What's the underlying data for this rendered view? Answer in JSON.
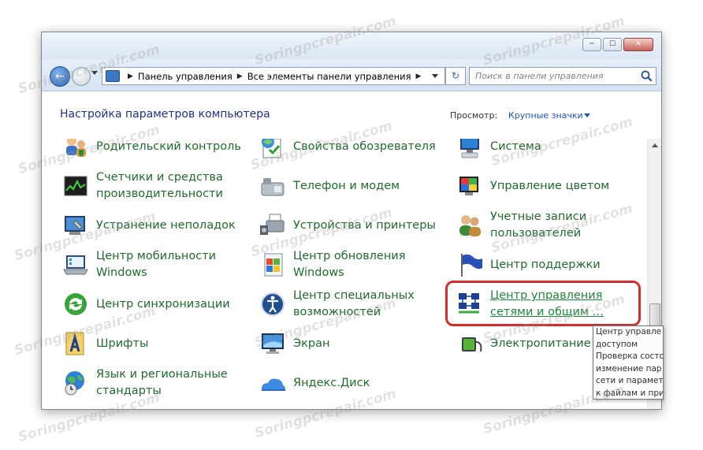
{
  "window": {
    "buttons": {
      "minimize": "─",
      "maximize": "☐",
      "close": "✕"
    }
  },
  "navbar": {
    "breadcrumb": [
      "Панель управления",
      "Все элементы панели управления"
    ],
    "separator": "▶",
    "refresh_icon": "↻",
    "search_placeholder": "Поиск в панели управления"
  },
  "header": {
    "title": "Настройка параметров компьютера",
    "view_label": "Просмотр:",
    "view_value": "Крупные значки"
  },
  "items": [
    {
      "label": "Родительский контроль",
      "icon": "parental-controls-icon"
    },
    {
      "label": "Свойства обозревателя",
      "icon": "internet-options-icon"
    },
    {
      "label": "Система",
      "icon": "system-icon"
    },
    {
      "label": "Счетчики и средства производительности",
      "icon": "performance-icon"
    },
    {
      "label": "Телефон и модем",
      "icon": "phone-modem-icon"
    },
    {
      "label": "Управление цветом",
      "icon": "color-management-icon"
    },
    {
      "label": "Устранение неполадок",
      "icon": "troubleshooting-icon"
    },
    {
      "label": "Устройства и принтеры",
      "icon": "devices-printers-icon"
    },
    {
      "label": "Учетные записи пользователей",
      "icon": "user-accounts-icon"
    },
    {
      "label": "Центр мобильности Windows",
      "icon": "mobility-center-icon"
    },
    {
      "label": "Центр обновления Windows",
      "icon": "windows-update-icon"
    },
    {
      "label": "Центр поддержки",
      "icon": "action-center-icon"
    },
    {
      "label": "Центр синхронизации",
      "icon": "sync-center-icon"
    },
    {
      "label": "Центр специальных возможностей",
      "icon": "ease-of-access-icon"
    },
    {
      "label": "Центр управления сетями и общим …",
      "icon": "network-sharing-icon"
    },
    {
      "label": "Шрифты",
      "icon": "fonts-icon"
    },
    {
      "label": "Экран",
      "icon": "display-icon"
    },
    {
      "label": "Электропитание",
      "icon": "power-options-icon"
    },
    {
      "label": "Язык и региональные стандарты",
      "icon": "region-language-icon"
    },
    {
      "label": "Яндекс.Диск",
      "icon": "yandex-disk-icon"
    }
  ],
  "tooltip": {
    "lines": [
      "Центр управле",
      "доступом",
      "Проверка состо",
      "изменение пар",
      "сети и парамет",
      "к файлам и при"
    ]
  },
  "watermark": "Soringpcrepair.com",
  "colors": {
    "link_green": "#1f6b2b",
    "title_blue": "#1e3287",
    "highlight_red": "#d42d2d"
  }
}
